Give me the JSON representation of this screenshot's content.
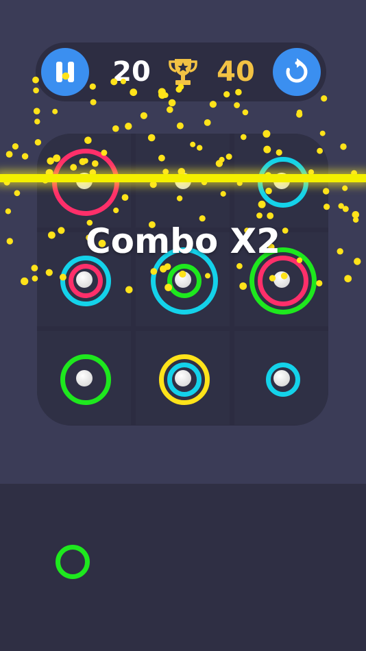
{
  "hud": {
    "score": "20",
    "best_score": "40",
    "pause_icon": "pause-icon",
    "best_icon": "trophy-icon",
    "restart_icon": "restart-icon"
  },
  "combo_text": "Combo X2",
  "colors": {
    "pink": "#ff2f6a",
    "cyan": "#14d2ea",
    "green": "#1ee81e",
    "yellow": "#ffe31a",
    "laser": "#f4f000",
    "accent_button": "#3b8ff0",
    "score_gold": "#f2c244"
  },
  "board": {
    "rows": 3,
    "cols": 3,
    "cells": [
      [
        {
          "rings": [
            {
              "size": "large",
              "color": "pink"
            }
          ]
        },
        {
          "rings": []
        },
        {
          "rings": [
            {
              "size": "medium",
              "color": "cyan"
            }
          ]
        }
      ],
      [
        {
          "rings": [
            {
              "size": "medium",
              "color": "cyan"
            },
            {
              "size": "small",
              "color": "pink"
            }
          ]
        },
        {
          "rings": [
            {
              "size": "large",
              "color": "cyan"
            },
            {
              "size": "small",
              "color": "green"
            }
          ]
        },
        {
          "rings": [
            {
              "size": "large",
              "color": "green"
            },
            {
              "size": "medium",
              "color": "pink"
            }
          ]
        }
      ],
      [
        {
          "rings": [
            {
              "size": "medium",
              "color": "green"
            }
          ]
        },
        {
          "rings": [
            {
              "size": "medium",
              "color": "yellow"
            },
            {
              "size": "small",
              "color": "cyan"
            }
          ]
        },
        {
          "rings": [
            {
              "size": "small",
              "color": "cyan"
            }
          ]
        }
      ]
    ]
  },
  "next_piece": {
    "rings": [
      {
        "size": "small",
        "color": "green"
      }
    ]
  }
}
